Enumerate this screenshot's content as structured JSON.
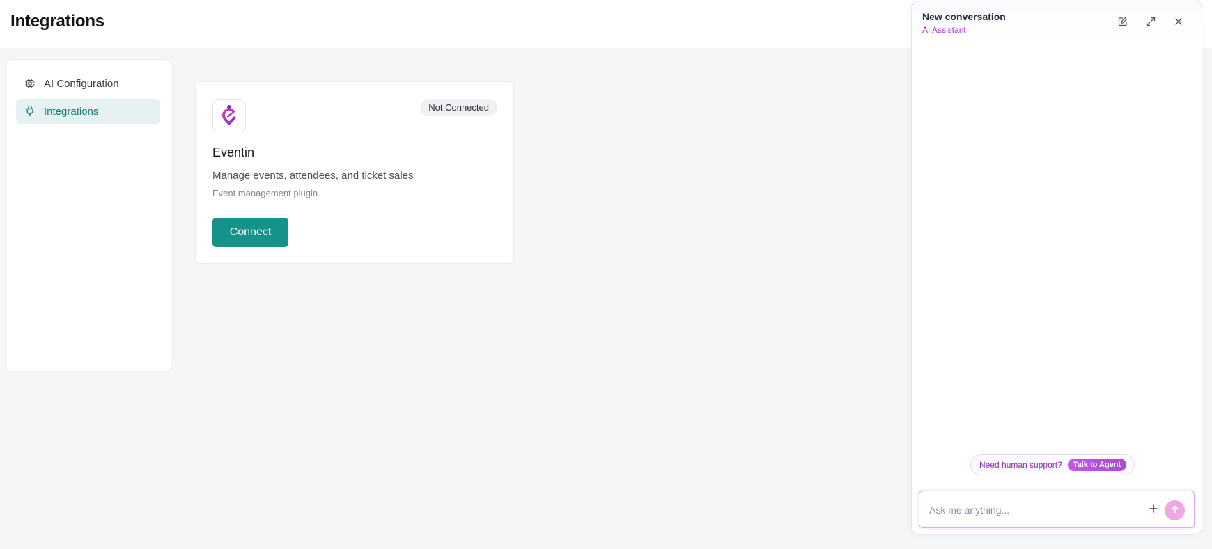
{
  "page": {
    "title": "Integrations"
  },
  "sidebar": {
    "items": [
      {
        "label": "AI Configuration",
        "icon": "cpu-chip-icon",
        "active": false
      },
      {
        "label": "Integrations",
        "icon": "plug-icon",
        "active": true
      }
    ]
  },
  "integrations": [
    {
      "name": "Eventin",
      "status": "Not Connected",
      "description": "Manage events, attendees, and ticket sales",
      "subtitle": "Event management plugin",
      "action_label": "Connect",
      "logo": "eventin-logo"
    }
  ],
  "chat": {
    "title": "New conversation",
    "subtitle": "AI Assistant",
    "support_text": "Need human support?",
    "talk_label": "Talk to Agent",
    "input_placeholder": "Ask me anything...",
    "input_value": ""
  },
  "colors": {
    "accent": "#15928a",
    "active_bg": "#e6f2f1",
    "assistant_purple": "#b02fd8"
  }
}
